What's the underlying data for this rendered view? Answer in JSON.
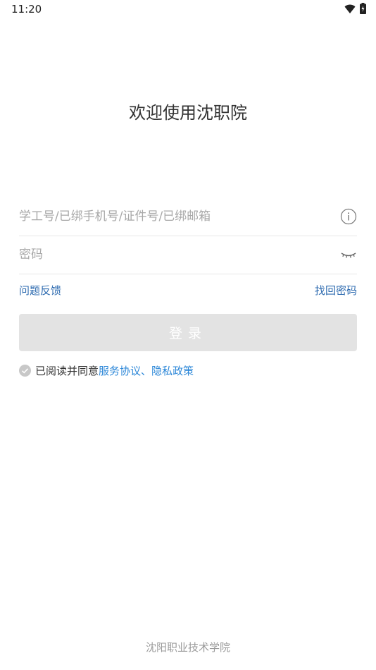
{
  "status_bar": {
    "time": "11:20",
    "icons": [
      "wifi-icon",
      "battery-charging-icon"
    ]
  },
  "welcome": {
    "title": "欢迎使用沈职院"
  },
  "login_form": {
    "account_placeholder": "学工号/已绑手机号/证件号/已绑邮箱",
    "account_value": "",
    "account_icon": "info-icon",
    "password_placeholder": "密码",
    "password_value": "",
    "password_icon": "eye-closed-icon"
  },
  "links": {
    "feedback": "问题反馈",
    "forgot_password": "找回密码"
  },
  "login_button": {
    "label": "登录"
  },
  "agreement": {
    "prefix": "已阅读并同意",
    "service_link": "服务协议",
    "separator": "、",
    "privacy_link": "隐私政策",
    "checked": false
  },
  "footer": {
    "text": "沈阳职业技术学院"
  },
  "colors": {
    "link": "#2e6bb0",
    "agreement_link": "#2e88d8",
    "button_disabled": "#e3e3e3",
    "placeholder": "#a8a8a8"
  }
}
